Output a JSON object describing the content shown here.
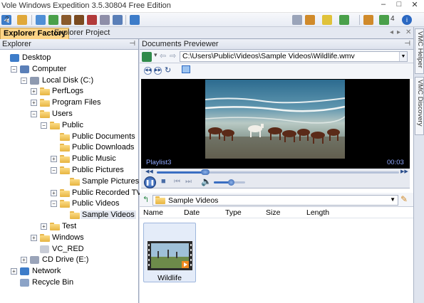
{
  "window": {
    "title": "Vole Windows Expedition  3.5.30804  Free Edition",
    "min": "–",
    "max": "□",
    "close": "✕"
  },
  "toolbar": {
    "counter_label": "2",
    "badge_count": "4"
  },
  "tabs": {
    "explorer_factory": "Explorer Factory",
    "explorer_project": "Explorer Project",
    "scroll_left": "◂",
    "scroll_right": "▸",
    "close": "✕"
  },
  "side_tabs": {
    "helper": "VMC Helper",
    "discovery": "VMC Discovery"
  },
  "explorer": {
    "title": "Explorer",
    "pin": "⊣",
    "tree": [
      {
        "label": "Desktop",
        "level": 0,
        "expander": "",
        "icon": "desktop-icon"
      },
      {
        "label": "Computer",
        "level": 1,
        "expander": "−",
        "icon": "computer-icon"
      },
      {
        "label": "Local Disk (C:)",
        "level": 2,
        "expander": "−",
        "icon": "drive-icon"
      },
      {
        "label": "PerfLogs",
        "level": 3,
        "expander": "+",
        "icon": "folder-icon"
      },
      {
        "label": "Program Files",
        "level": 3,
        "expander": "+",
        "icon": "folder-icon"
      },
      {
        "label": "Users",
        "level": 3,
        "expander": "−",
        "icon": "folder-icon"
      },
      {
        "label": "Public",
        "level": 4,
        "expander": "−",
        "icon": "folder-icon"
      },
      {
        "label": "Public Documents",
        "level": 5,
        "expander": "",
        "icon": "folder-icon"
      },
      {
        "label": "Public Downloads",
        "level": 5,
        "expander": "",
        "icon": "folder-icon"
      },
      {
        "label": "Public Music",
        "level": 5,
        "expander": "+",
        "icon": "folder-icon"
      },
      {
        "label": "Public Pictures",
        "level": 5,
        "expander": "−",
        "icon": "folder-icon"
      },
      {
        "label": "Sample Pictures",
        "level": 6,
        "expander": "",
        "icon": "folder-icon"
      },
      {
        "label": "Public Recorded TV",
        "level": 5,
        "expander": "+",
        "icon": "folder-icon"
      },
      {
        "label": "Public Videos",
        "level": 5,
        "expander": "−",
        "icon": "folder-icon"
      },
      {
        "label": "Sample Videos",
        "level": 6,
        "expander": "",
        "icon": "folder-icon",
        "selected": true
      },
      {
        "label": "Test",
        "level": 4,
        "expander": "+",
        "icon": "folder-icon"
      },
      {
        "label": "Windows",
        "level": 3,
        "expander": "+",
        "icon": "folder-icon"
      },
      {
        "label": "VC_RED",
        "level": 3,
        "expander": "",
        "icon": "file-icon"
      },
      {
        "label": "CD Drive (E:)",
        "level": 2,
        "expander": "+",
        "icon": "cd-drive-icon"
      },
      {
        "label": "Network",
        "level": 1,
        "expander": "+",
        "icon": "network-icon"
      },
      {
        "label": "Recycle Bin",
        "level": 1,
        "expander": "",
        "icon": "recycle-bin-icon"
      }
    ]
  },
  "previewer": {
    "title": "Documents Previewer",
    "pin": "⊣",
    "path": "C:\\Users\\Public\\Videos\\Sample Videos\\Wildlife.wmv",
    "playlist_label": "Playlist3",
    "time": "00:03",
    "seek_fraction": 0.2,
    "volume_fraction": 0.55
  },
  "folder_browser": {
    "current_folder": "Sample Videos",
    "columns": [
      "Name",
      "Date",
      "Type",
      "Size",
      "Length"
    ],
    "items": [
      {
        "label": "Wildlife",
        "icon": "video-thumbnail"
      }
    ]
  },
  "colors": {
    "accent": "#fdd486",
    "pane_header": "#dde2ed",
    "selection": "#e4ecf9"
  }
}
